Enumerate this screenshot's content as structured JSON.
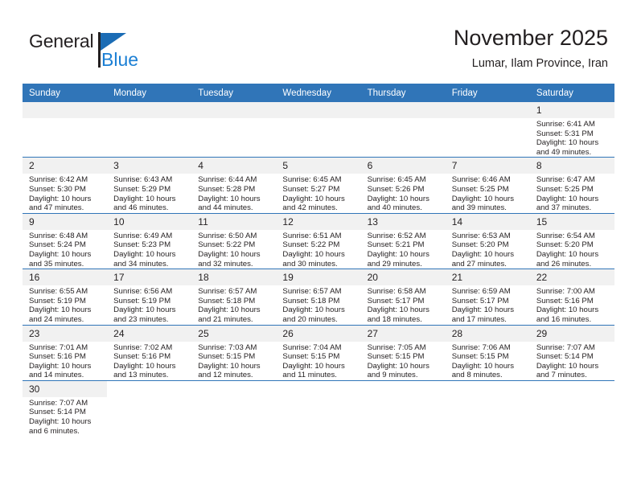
{
  "brand": {
    "name_top": "General",
    "name_bottom": "Blue",
    "accent_color": "#1b6cb5",
    "blue_text_color": "#1b7fd4"
  },
  "header": {
    "title": "November 2025",
    "subtitle": "Lumar, Ilam Province, Iran"
  },
  "calendar": {
    "header_bg": "#3075b8",
    "daynum_bg": "#f1f1f1",
    "weekday_headers": [
      "Sunday",
      "Monday",
      "Tuesday",
      "Wednesday",
      "Thursday",
      "Friday",
      "Saturday"
    ],
    "labels": {
      "sunrise": "Sunrise:",
      "sunset": "Sunset:",
      "daylight": "Daylight:"
    },
    "weeks": [
      [
        {
          "day": "",
          "empty": true
        },
        {
          "day": "",
          "empty": true
        },
        {
          "day": "",
          "empty": true
        },
        {
          "day": "",
          "empty": true
        },
        {
          "day": "",
          "empty": true
        },
        {
          "day": "",
          "empty": true
        },
        {
          "day": "1",
          "sunrise": "Sunrise: 6:41 AM",
          "sunset": "Sunset: 5:31 PM",
          "daylight_1": "Daylight: 10 hours",
          "daylight_2": "and 49 minutes."
        }
      ],
      [
        {
          "day": "2",
          "sunrise": "Sunrise: 6:42 AM",
          "sunset": "Sunset: 5:30 PM",
          "daylight_1": "Daylight: 10 hours",
          "daylight_2": "and 47 minutes."
        },
        {
          "day": "3",
          "sunrise": "Sunrise: 6:43 AM",
          "sunset": "Sunset: 5:29 PM",
          "daylight_1": "Daylight: 10 hours",
          "daylight_2": "and 46 minutes."
        },
        {
          "day": "4",
          "sunrise": "Sunrise: 6:44 AM",
          "sunset": "Sunset: 5:28 PM",
          "daylight_1": "Daylight: 10 hours",
          "daylight_2": "and 44 minutes."
        },
        {
          "day": "5",
          "sunrise": "Sunrise: 6:45 AM",
          "sunset": "Sunset: 5:27 PM",
          "daylight_1": "Daylight: 10 hours",
          "daylight_2": "and 42 minutes."
        },
        {
          "day": "6",
          "sunrise": "Sunrise: 6:45 AM",
          "sunset": "Sunset: 5:26 PM",
          "daylight_1": "Daylight: 10 hours",
          "daylight_2": "and 40 minutes."
        },
        {
          "day": "7",
          "sunrise": "Sunrise: 6:46 AM",
          "sunset": "Sunset: 5:25 PM",
          "daylight_1": "Daylight: 10 hours",
          "daylight_2": "and 39 minutes."
        },
        {
          "day": "8",
          "sunrise": "Sunrise: 6:47 AM",
          "sunset": "Sunset: 5:25 PM",
          "daylight_1": "Daylight: 10 hours",
          "daylight_2": "and 37 minutes."
        }
      ],
      [
        {
          "day": "9",
          "sunrise": "Sunrise: 6:48 AM",
          "sunset": "Sunset: 5:24 PM",
          "daylight_1": "Daylight: 10 hours",
          "daylight_2": "and 35 minutes."
        },
        {
          "day": "10",
          "sunrise": "Sunrise: 6:49 AM",
          "sunset": "Sunset: 5:23 PM",
          "daylight_1": "Daylight: 10 hours",
          "daylight_2": "and 34 minutes."
        },
        {
          "day": "11",
          "sunrise": "Sunrise: 6:50 AM",
          "sunset": "Sunset: 5:22 PM",
          "daylight_1": "Daylight: 10 hours",
          "daylight_2": "and 32 minutes."
        },
        {
          "day": "12",
          "sunrise": "Sunrise: 6:51 AM",
          "sunset": "Sunset: 5:22 PM",
          "daylight_1": "Daylight: 10 hours",
          "daylight_2": "and 30 minutes."
        },
        {
          "day": "13",
          "sunrise": "Sunrise: 6:52 AM",
          "sunset": "Sunset: 5:21 PM",
          "daylight_1": "Daylight: 10 hours",
          "daylight_2": "and 29 minutes."
        },
        {
          "day": "14",
          "sunrise": "Sunrise: 6:53 AM",
          "sunset": "Sunset: 5:20 PM",
          "daylight_1": "Daylight: 10 hours",
          "daylight_2": "and 27 minutes."
        },
        {
          "day": "15",
          "sunrise": "Sunrise: 6:54 AM",
          "sunset": "Sunset: 5:20 PM",
          "daylight_1": "Daylight: 10 hours",
          "daylight_2": "and 26 minutes."
        }
      ],
      [
        {
          "day": "16",
          "sunrise": "Sunrise: 6:55 AM",
          "sunset": "Sunset: 5:19 PM",
          "daylight_1": "Daylight: 10 hours",
          "daylight_2": "and 24 minutes."
        },
        {
          "day": "17",
          "sunrise": "Sunrise: 6:56 AM",
          "sunset": "Sunset: 5:19 PM",
          "daylight_1": "Daylight: 10 hours",
          "daylight_2": "and 23 minutes."
        },
        {
          "day": "18",
          "sunrise": "Sunrise: 6:57 AM",
          "sunset": "Sunset: 5:18 PM",
          "daylight_1": "Daylight: 10 hours",
          "daylight_2": "and 21 minutes."
        },
        {
          "day": "19",
          "sunrise": "Sunrise: 6:57 AM",
          "sunset": "Sunset: 5:18 PM",
          "daylight_1": "Daylight: 10 hours",
          "daylight_2": "and 20 minutes."
        },
        {
          "day": "20",
          "sunrise": "Sunrise: 6:58 AM",
          "sunset": "Sunset: 5:17 PM",
          "daylight_1": "Daylight: 10 hours",
          "daylight_2": "and 18 minutes."
        },
        {
          "day": "21",
          "sunrise": "Sunrise: 6:59 AM",
          "sunset": "Sunset: 5:17 PM",
          "daylight_1": "Daylight: 10 hours",
          "daylight_2": "and 17 minutes."
        },
        {
          "day": "22",
          "sunrise": "Sunrise: 7:00 AM",
          "sunset": "Sunset: 5:16 PM",
          "daylight_1": "Daylight: 10 hours",
          "daylight_2": "and 16 minutes."
        }
      ],
      [
        {
          "day": "23",
          "sunrise": "Sunrise: 7:01 AM",
          "sunset": "Sunset: 5:16 PM",
          "daylight_1": "Daylight: 10 hours",
          "daylight_2": "and 14 minutes."
        },
        {
          "day": "24",
          "sunrise": "Sunrise: 7:02 AM",
          "sunset": "Sunset: 5:16 PM",
          "daylight_1": "Daylight: 10 hours",
          "daylight_2": "and 13 minutes."
        },
        {
          "day": "25",
          "sunrise": "Sunrise: 7:03 AM",
          "sunset": "Sunset: 5:15 PM",
          "daylight_1": "Daylight: 10 hours",
          "daylight_2": "and 12 minutes."
        },
        {
          "day": "26",
          "sunrise": "Sunrise: 7:04 AM",
          "sunset": "Sunset: 5:15 PM",
          "daylight_1": "Daylight: 10 hours",
          "daylight_2": "and 11 minutes."
        },
        {
          "day": "27",
          "sunrise": "Sunrise: 7:05 AM",
          "sunset": "Sunset: 5:15 PM",
          "daylight_1": "Daylight: 10 hours",
          "daylight_2": "and 9 minutes."
        },
        {
          "day": "28",
          "sunrise": "Sunrise: 7:06 AM",
          "sunset": "Sunset: 5:15 PM",
          "daylight_1": "Daylight: 10 hours",
          "daylight_2": "and 8 minutes."
        },
        {
          "day": "29",
          "sunrise": "Sunrise: 7:07 AM",
          "sunset": "Sunset: 5:14 PM",
          "daylight_1": "Daylight: 10 hours",
          "daylight_2": "and 7 minutes."
        }
      ],
      [
        {
          "day": "30",
          "sunrise": "Sunrise: 7:07 AM",
          "sunset": "Sunset: 5:14 PM",
          "daylight_1": "Daylight: 10 hours",
          "daylight_2": "and 6 minutes."
        },
        {
          "day": "",
          "blank": true
        },
        {
          "day": "",
          "blank": true
        },
        {
          "day": "",
          "blank": true
        },
        {
          "day": "",
          "blank": true
        },
        {
          "day": "",
          "blank": true
        },
        {
          "day": "",
          "blank": true
        }
      ]
    ]
  }
}
